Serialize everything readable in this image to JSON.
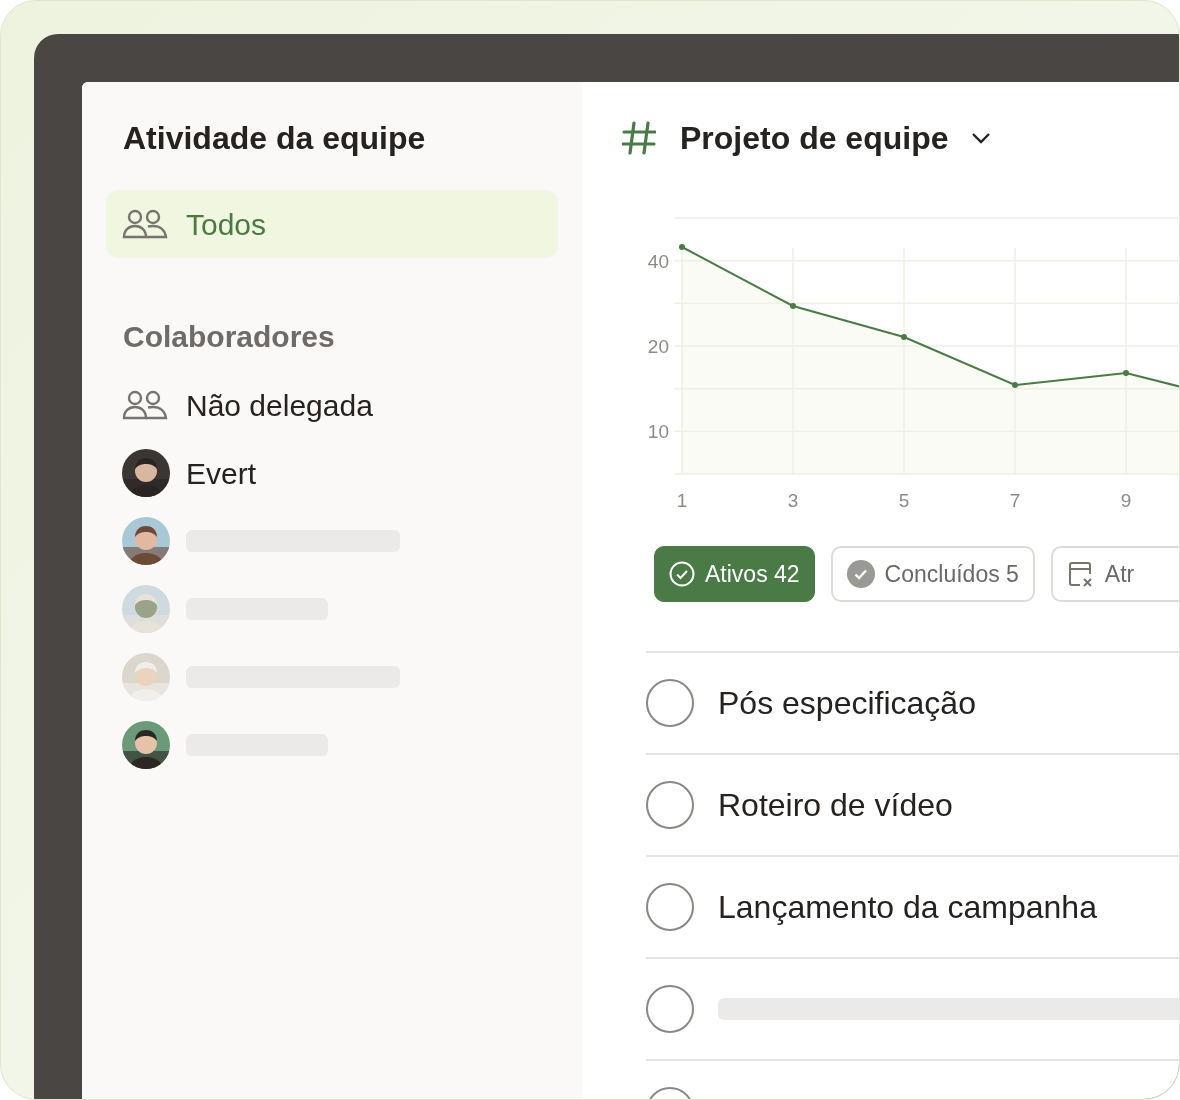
{
  "sidebar": {
    "title": "Atividade da equipe",
    "items": [
      {
        "label": "Todos",
        "selected": true
      }
    ],
    "section": "Colaboradores",
    "collaborators": [
      {
        "kind": "group",
        "name": "Não delegada"
      },
      {
        "kind": "person",
        "name": "Evert"
      },
      {
        "kind": "skeleton"
      },
      {
        "kind": "skeleton"
      },
      {
        "kind": "skeleton"
      },
      {
        "kind": "skeleton"
      }
    ]
  },
  "project": {
    "title": "Projeto de equipe",
    "chart": {
      "y_labels": [
        "40",
        "20",
        "10"
      ],
      "x_labels": [
        "1",
        "3",
        "5",
        "7",
        "9"
      ]
    },
    "filters": [
      {
        "kind": "active",
        "label": "Ativos 42",
        "selected": true
      },
      {
        "kind": "done",
        "label": "Concluídos 5",
        "selected": false
      },
      {
        "kind": "overdue",
        "label": "Atr",
        "selected": false
      }
    ],
    "tasks": [
      {
        "kind": "task",
        "title": "Pós especificação",
        "checked": false
      },
      {
        "kind": "task",
        "title": "Roteiro de vídeo",
        "checked": false
      },
      {
        "kind": "task",
        "title": "Lançamento da campanha",
        "checked": false
      },
      {
        "kind": "skeleton",
        "checked": false
      },
      {
        "kind": "empty",
        "checked": false
      }
    ]
  }
}
